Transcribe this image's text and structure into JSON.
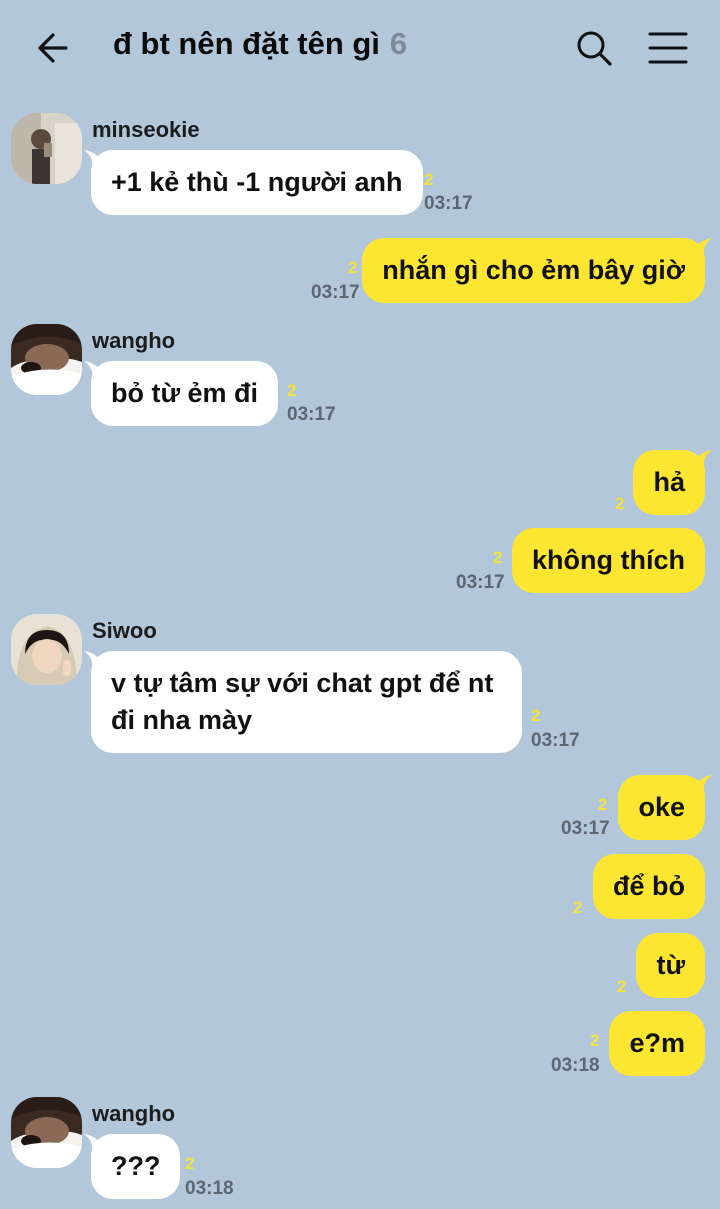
{
  "header": {
    "title": "đ bt nên đặt tên gì",
    "member_count": "6"
  },
  "colors": {
    "background": "#b2c7da",
    "incoming_bubble": "#ffffff",
    "outgoing_bubble": "#fde631",
    "unread": "#f6e13a",
    "time": "#5d6773"
  },
  "messages": [
    {
      "sender": "minseokie",
      "text": "+1 kẻ thù -1 người anh",
      "unread": "2",
      "time": "03:17"
    },
    {
      "text": "nhắn gì cho ẻm bây giờ",
      "unread": "2",
      "time": "03:17"
    },
    {
      "sender": "wangho",
      "text": "bỏ từ ẻm đi",
      "unread": "2",
      "time": "03:17"
    },
    {
      "text": "hả",
      "unread": "2"
    },
    {
      "text": "không thích",
      "unread": "2",
      "time": "03:17"
    },
    {
      "sender": "Siwoo",
      "text": "v tự tâm sự với chat gpt để nt đi nha mày",
      "unread": "2",
      "time": "03:17"
    },
    {
      "text": "oke",
      "unread": "2",
      "time": "03:17"
    },
    {
      "text": "để bỏ",
      "unread": "2"
    },
    {
      "text": "từ",
      "unread": "2"
    },
    {
      "text": "e?m",
      "unread": "2",
      "time": "03:18"
    },
    {
      "sender": "wangho",
      "text": "???",
      "unread": "2",
      "time": "03:18"
    }
  ]
}
